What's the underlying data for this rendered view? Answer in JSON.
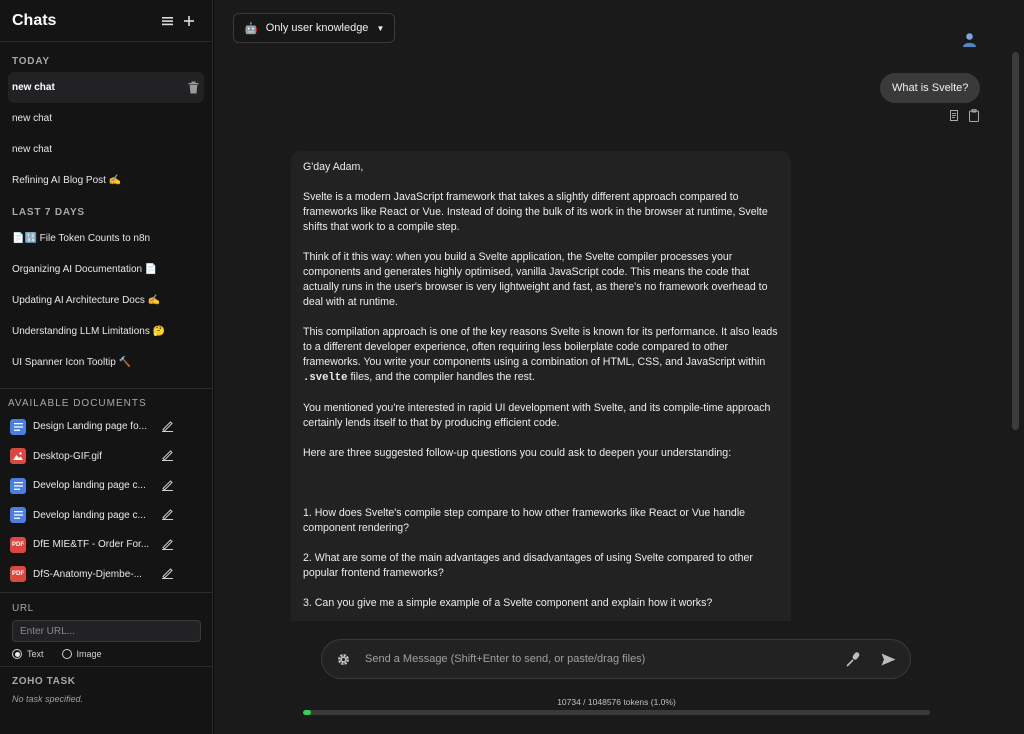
{
  "sidebar": {
    "title": "Chats",
    "today_label": "TODAY",
    "today": [
      {
        "label": "new chat"
      },
      {
        "label": "new chat"
      },
      {
        "label": "new chat"
      },
      {
        "label": "Refining AI Blog Post ✍️"
      }
    ],
    "last7_label": "LAST 7 DAYS",
    "last7": [
      {
        "label": "📄🔢 File Token Counts to n8n"
      },
      {
        "label": "Organizing AI Documentation 📄"
      },
      {
        "label": "Updating AI Architecture Docs ✍️"
      },
      {
        "label": "Understanding LLM Limitations 🤔"
      },
      {
        "label": "UI Spanner Icon Tooltip 🔨"
      }
    ],
    "docs_label": "AVAILABLE DOCUMENTS",
    "documents": [
      {
        "name": "Design Landing page fo...",
        "type": "gdoc"
      },
      {
        "name": "Desktop-GIF.gif",
        "type": "image"
      },
      {
        "name": "Develop landing page c...",
        "type": "gdoc"
      },
      {
        "name": "Develop landing page c...",
        "type": "gdoc"
      },
      {
        "name": "DfE MIE&TF - Order For...",
        "type": "pdf"
      },
      {
        "name": "DfS-Anatomy-Djembe-...",
        "type": "pdf"
      }
    ],
    "pdf_badge": "PDF",
    "url_label": "URL",
    "url_placeholder": "Enter URL...",
    "radio_text": "Text",
    "radio_image": "Image",
    "radio_selected": "Text",
    "zoho_label": "ZOHO TASK",
    "zoho_status": "No task specified."
  },
  "main": {
    "model_selector": "Only user knowledge",
    "user_message": "What is Svelte?",
    "assistant": {
      "greeting": "G'day Adam,",
      "p1": "Svelte is a modern JavaScript framework that takes a slightly different approach compared to frameworks like React or Vue. Instead of doing the bulk of its work in the browser at runtime, Svelte shifts that work to a compile step.",
      "p2": "Think of it this way: when you build a Svelte application, the Svelte compiler processes your components and generates highly optimised, vanilla JavaScript code. This means the code that actually runs in the user's browser is very lightweight and fast, as there's no framework overhead to deal with at runtime.",
      "p3a": "This compilation approach is one of the key reasons Svelte is known for its performance. It also leads to a different developer experience, often requiring less boilerplate code compared to other frameworks. You write your components using a combination of HTML, CSS, and JavaScript within ",
      "p3code": ".svelte",
      "p3b": " files, and the compiler handles the rest.",
      "p4": "You mentioned you're interested in rapid UI development with Svelte, and its compile-time approach certainly lends itself to that by producing efficient code.",
      "p5": "Here are three suggested follow-up questions you could ask to deepen your understanding:",
      "q1": "1. How does Svelte's compile step compare to how other frameworks like React or Vue handle component rendering?",
      "q2": "2. What are some of the main advantages and disadvantages of using Svelte compared to other popular frontend frameworks?",
      "q3": "3. Can you give me a simple example of a Svelte component and explain how it works?"
    },
    "composer_placeholder": "Send a Message (Shift+Enter to send, or paste/drag files)",
    "tokens_text": "10734 / 1048576 tokens (1.0%)",
    "tokens_fraction": 0.01
  },
  "colors": {
    "progress": "#34d058",
    "doc_blue": "#4a7fe0",
    "doc_red": "#d9493f"
  }
}
